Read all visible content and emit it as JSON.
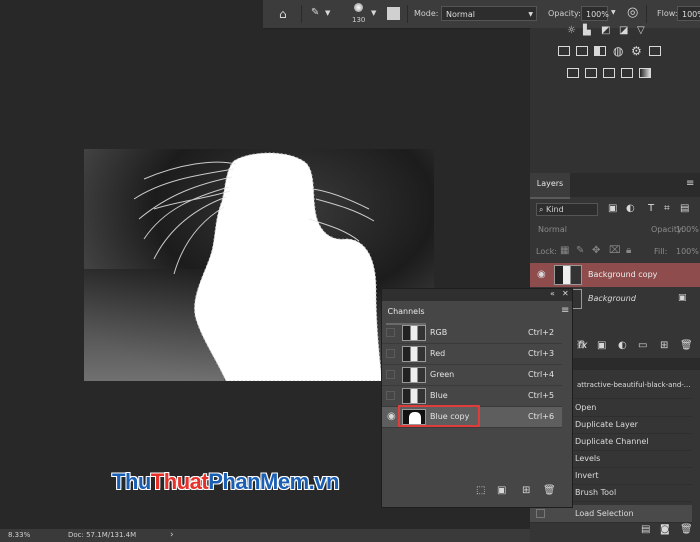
{
  "options_bar": {
    "brush_size": "130",
    "mode_label": "Mode:",
    "mode_value": "Normal",
    "opacity_label": "Opacity:",
    "opacity_value": "100%",
    "flow_label": "Flow:",
    "flow_value": "100%"
  },
  "layers_panel": {
    "tab_label": "Layers",
    "filter_value": "Kind",
    "blend_mode": "Normal",
    "opacity_label": "Opacity:",
    "opacity_value": "100%",
    "lock_label": "Lock:",
    "fill_label": "Fill:",
    "fill_value": "100%",
    "layers": [
      {
        "name": "Background copy",
        "selected": true
      },
      {
        "name": "Background",
        "selected": false
      }
    ]
  },
  "channels_panel": {
    "tab_label": "Channels",
    "channels": [
      {
        "name": "RGB",
        "shortcut": "Ctrl+2"
      },
      {
        "name": "Red",
        "shortcut": "Ctrl+3"
      },
      {
        "name": "Green",
        "shortcut": "Ctrl+4"
      },
      {
        "name": "Blue",
        "shortcut": "Ctrl+5"
      },
      {
        "name": "Blue copy",
        "shortcut": "Ctrl+6"
      }
    ]
  },
  "history_panel": {
    "document": "attractive-beautiful-black-and-...",
    "steps": [
      "Open",
      "Duplicate Layer",
      "Duplicate Channel",
      "Levels",
      "Invert",
      "Brush Tool",
      "Load Selection"
    ]
  },
  "status_bar": {
    "zoom": "8.33%",
    "doc_size": "Doc: 57.1M/131.4M",
    "arrow": "›"
  },
  "watermark": {
    "part1": "Thu",
    "part2": "Thuat",
    "part3": "PhanMem",
    "part4": ".vn",
    "colors": {
      "red": "#e8302a",
      "blue": "#1a5fb4"
    }
  },
  "colors": {
    "selected_layer": "#8e4c4c",
    "highlight_box": "#e03c3c"
  }
}
